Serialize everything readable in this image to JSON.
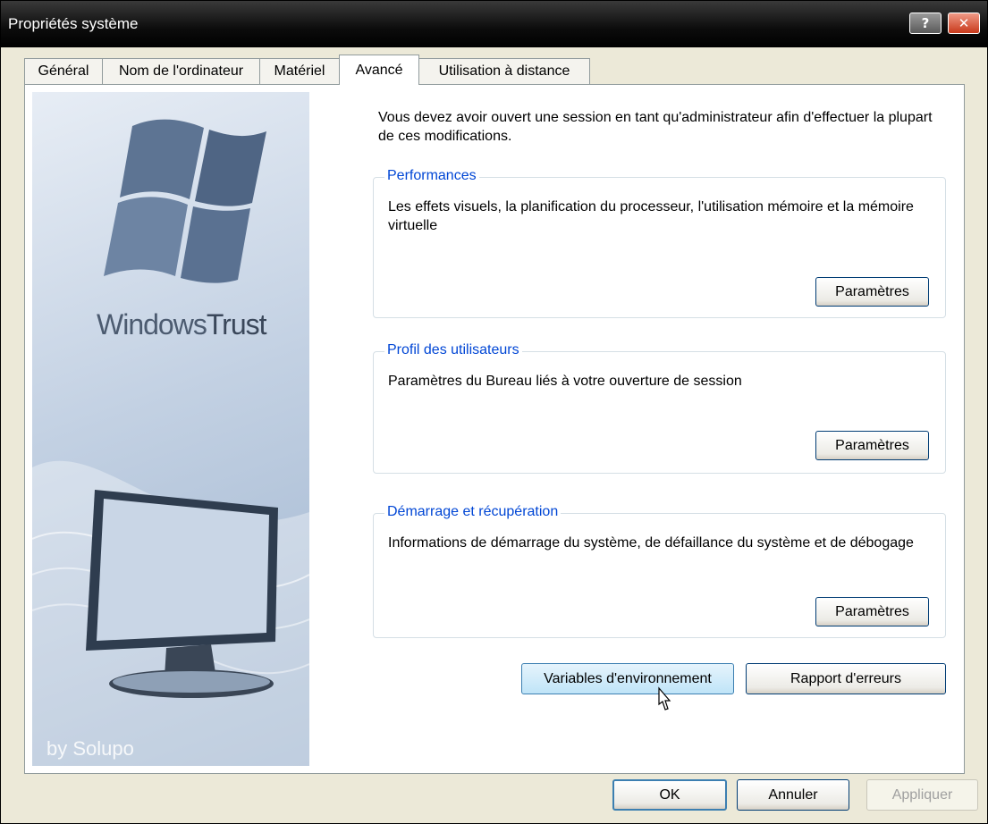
{
  "window": {
    "title": "Propriétés système",
    "help_label": "?",
    "close_label": "✕"
  },
  "tabs": [
    {
      "label": "Général"
    },
    {
      "label": "Nom de l'ordinateur"
    },
    {
      "label": "Matériel"
    },
    {
      "label": "Avancé",
      "active": true
    },
    {
      "label": "Utilisation à distance"
    }
  ],
  "sidebar": {
    "brand_light": "Windows",
    "brand_bold": "Trust",
    "byline": "by Solupo"
  },
  "admin_notice": "Vous devez avoir ouvert une session en tant qu'administrateur afin d'effectuer la plupart de ces modifications.",
  "groups": [
    {
      "title": "Performances",
      "description": "Les effets visuels, la planification du processeur, l'utilisation mémoire et la mémoire virtuelle",
      "button": "Paramètres"
    },
    {
      "title": "Profil des utilisateurs",
      "description": "Paramètres du Bureau liés à votre ouverture de session",
      "button": "Paramètres"
    },
    {
      "title": "Démarrage et récupération",
      "description": "Informations de démarrage du système, de défaillance du système et de débogage",
      "button": "Paramètres"
    }
  ],
  "actions": {
    "env_vars": "Variables d'environnement",
    "error_report": "Rapport d'erreurs"
  },
  "footer": {
    "ok": "OK",
    "cancel": "Annuler",
    "apply": "Appliquer"
  },
  "colors": {
    "group_title": "#0046d5",
    "titlebar": "#000000",
    "close": "#c8391b"
  },
  "icons": [
    "help-icon",
    "close-icon",
    "windows-logo-icon",
    "monitor-icon",
    "cursor-icon"
  ]
}
